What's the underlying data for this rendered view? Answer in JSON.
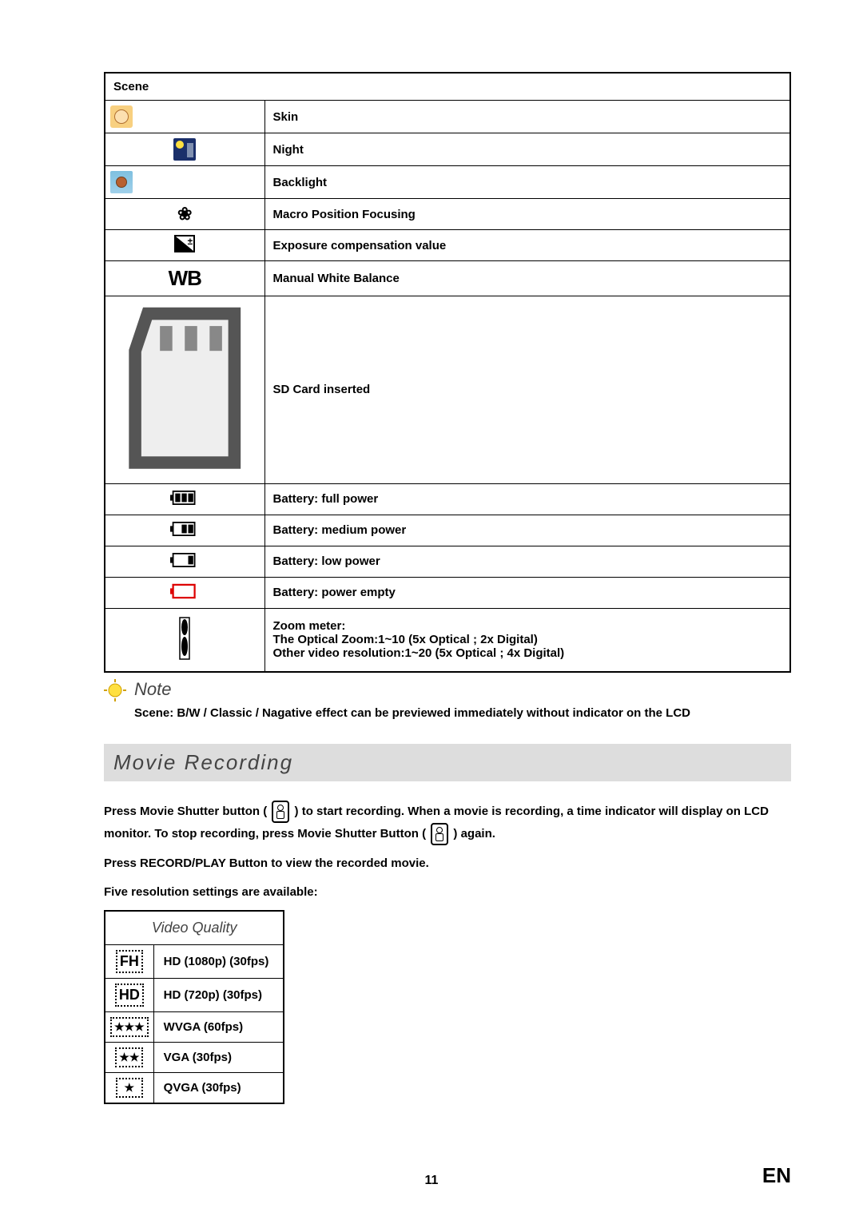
{
  "scene_table": {
    "header": "Scene",
    "rows": [
      {
        "icon": "skin",
        "label": "Skin"
      },
      {
        "icon": "night",
        "label": "Night"
      },
      {
        "icon": "backlight",
        "label": "Backlight"
      },
      {
        "icon": "macro",
        "label": "Macro Position Focusing"
      },
      {
        "icon": "ev",
        "label": "Exposure compensation value"
      },
      {
        "icon": "wb",
        "label": "Manual White Balance"
      },
      {
        "icon": "sd",
        "label": "SD Card inserted"
      },
      {
        "icon": "batt_full",
        "label": "Battery: full power"
      },
      {
        "icon": "batt_med",
        "label": "Battery: medium power"
      },
      {
        "icon": "batt_low",
        "label": "Battery: low power"
      },
      {
        "icon": "batt_empty",
        "label": "Battery: power empty"
      }
    ],
    "zoom": {
      "line1": "Zoom meter:",
      "line2": "The Optical Zoom:1~10 (5x Optical ; 2x Digital)",
      "line3": "Other video resolution:1~20 (5x Optical ; 4x Digital)"
    }
  },
  "note": {
    "title": "Note",
    "text": "Scene: B/W / Classic / Nagative effect can be previewed immediately without indicator on the LCD"
  },
  "section_heading": "Movie Recording",
  "movie_text": {
    "p1a": "Press Movie Shutter button (",
    "p1b": ") to start recording. When a movie is recording, a time indicator will display on LCD monitor. To stop recording, press Movie Shutter Button (",
    "p1c": ") again.",
    "p2": "Press RECORD/PLAY Button to view the recorded movie.",
    "p3": "Five resolution settings are available:"
  },
  "res_table": {
    "header": "Video Quality",
    "rows": [
      {
        "badge": "FH",
        "label": "HD (1080p) (30fps)"
      },
      {
        "badge": "HD",
        "label": "HD (720p) (30fps)"
      },
      {
        "badge": "★★★",
        "label": "WVGA (60fps)"
      },
      {
        "badge": "★★",
        "label": "VGA (30fps)"
      },
      {
        "badge": "★",
        "label": "QVGA (30fps)"
      }
    ]
  },
  "footer": {
    "page": "11",
    "lang": "EN"
  }
}
